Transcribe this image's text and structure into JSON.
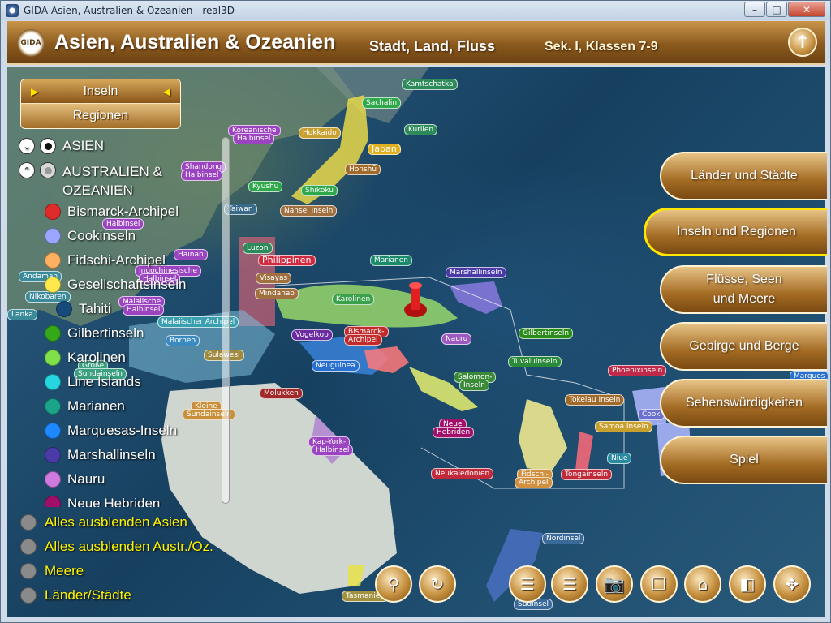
{
  "window": {
    "title": "GIDA Asien, Australien & Ozeanien - real3D",
    "min": "–",
    "max": "□",
    "close": "✕"
  },
  "header": {
    "logo": "GIDA",
    "title": "Asien, Australien & Ozeanien",
    "subtitle": "Stadt, Land, Fluss",
    "grade": "Sek. I, Klassen 7-9",
    "up_icon": "↑"
  },
  "tabs": {
    "active": "Inseln",
    "other": "Regionen",
    "arrow_left": "▶",
    "arrow_right": "◀"
  },
  "tree": {
    "asia": {
      "toggle": "⌄",
      "label": "ASIEN"
    },
    "oceania": {
      "toggle": "⌃",
      "label_1": "AUSTRALIEN &",
      "label_2": "OZEANIEN"
    },
    "items": [
      {
        "label": "Bismarck-Archipel",
        "color": "#e02b2b"
      },
      {
        "label": "Cookinseln",
        "color": "#9aa6ff"
      },
      {
        "label": "Fidschi-Archipel",
        "color": "#ffb060"
      },
      {
        "label": "Gesellschaftsinseln",
        "color": "#ffe94a"
      },
      {
        "label": "Tahiti",
        "color": "#174a7a",
        "sub": true
      },
      {
        "label": "Gilbertinseln",
        "color": "#35a81a"
      },
      {
        "label": "Karolinen",
        "color": "#7fe04a"
      },
      {
        "label": "Line Islands",
        "color": "#25d5e0"
      },
      {
        "label": "Marianen",
        "color": "#1aa58a"
      },
      {
        "label": "Marquesas-Inseln",
        "color": "#1e88ff"
      },
      {
        "label": "Marshallinseln",
        "color": "#4a3aa8"
      },
      {
        "label": "Nauru",
        "color": "#d07ae0"
      },
      {
        "label": "Neue Hebriden",
        "color": "#a0106a"
      }
    ]
  },
  "options": [
    {
      "label": "Alles ausblenden Asien"
    },
    {
      "label": "Alles ausblenden Austr./Oz."
    },
    {
      "label": "Meere"
    },
    {
      "label": "Länder/Städte"
    }
  ],
  "nav": [
    {
      "label": "Länder und Städte"
    },
    {
      "label": "Inseln und Regionen",
      "active": true
    },
    {
      "label_1": "Flüsse, Seen",
      "label_2": "und Meere"
    },
    {
      "label": "Gebirge und Berge"
    },
    {
      "label": "Sehenswürdigkeiten"
    },
    {
      "label": "Spiel"
    }
  ],
  "toolbar": {
    "pin": "⚲",
    "reset": "↻",
    "list1": "☰",
    "list2": "☰",
    "camera": "📷",
    "copy": "❐",
    "home": "⌂",
    "window": "◧",
    "move": "✥"
  },
  "map_labels": [
    {
      "text": "Kamtschatka",
      "bg": "#2e8a5a"
    },
    {
      "text": "Sachalin",
      "bg": "#2ea84a"
    },
    {
      "text": "Kurilen",
      "bg": "#2e8a5a"
    },
    {
      "text": "Koreanische",
      "bg": "#9a44c0"
    },
    {
      "text": "Halbinsel",
      "bg": "#9a44c0"
    },
    {
      "text": "Hokkaido",
      "bg": "#c8a030"
    },
    {
      "text": "Japan",
      "bg": "#e0b020"
    },
    {
      "text": "Honshū",
      "bg": "#a06a2a"
    },
    {
      "text": "Shandong",
      "bg": "#9a44c0"
    },
    {
      "text": "Halbinsel",
      "bg": "#9a44c0"
    },
    {
      "text": "Kyushu",
      "bg": "#2ea84a"
    },
    {
      "text": "Shikoku",
      "bg": "#2ea84a"
    },
    {
      "text": "Nansei Inseln",
      "bg": "#a07040"
    },
    {
      "text": "Taiwan",
      "bg": "#3a6a8a"
    },
    {
      "text": "Luzon",
      "bg": "#2e8a5a"
    },
    {
      "text": "Philippinen",
      "bg": "#d02a40"
    },
    {
      "text": "Visayas",
      "bg": "#a07040"
    },
    {
      "text": "Mindanao",
      "bg": "#a07040"
    },
    {
      "text": "Hainan",
      "bg": "#9a44c0"
    },
    {
      "text": "Indochinesische",
      "bg": "#9a44c0"
    },
    {
      "text": "Halbinsel",
      "bg": "#9a44c0"
    },
    {
      "text": "Malaiische",
      "bg": "#9a44c0"
    },
    {
      "text": "Halbinsel",
      "bg": "#9a44c0"
    },
    {
      "text": "Malaiischer Archipel",
      "bg": "#3aa0b0"
    },
    {
      "text": "Borneo",
      "bg": "#3a8ac0"
    },
    {
      "text": "Sulawesi",
      "bg": "#a08a40"
    },
    {
      "text": "Große",
      "bg": "#3aa080"
    },
    {
      "text": "Sundainseln",
      "bg": "#3aa080"
    },
    {
      "text": "Kleine",
      "bg": "#c8903a"
    },
    {
      "text": "Sundainseln",
      "bg": "#c8903a"
    },
    {
      "text": "Molukken",
      "bg": "#a02a2a"
    },
    {
      "text": "Vogelkop",
      "bg": "#6a2aa0"
    },
    {
      "text": "Bismarck-",
      "bg": "#c02a2a"
    },
    {
      "text": "Archipel",
      "bg": "#c02a2a"
    },
    {
      "text": "Neuguinea",
      "bg": "#2a70d0"
    },
    {
      "text": "Kap-York-",
      "bg": "#9a44c0"
    },
    {
      "text": "Halbinsel",
      "bg": "#9a44c0"
    },
    {
      "text": "Marianen",
      "bg": "#1a8a6a"
    },
    {
      "text": "Karolinen",
      "bg": "#3aa04a"
    },
    {
      "text": "Marshallinseln",
      "bg": "#4a3aa8"
    },
    {
      "text": "Nauru",
      "bg": "#9a5ac0"
    },
    {
      "text": "Gilbertinseln",
      "bg": "#2a8a1a"
    },
    {
      "text": "Tuvaluinseln",
      "bg": "#2a8a3a"
    },
    {
      "text": "Salomon-",
      "bg": "#3a8a3a"
    },
    {
      "text": "Inseln",
      "bg": "#3a8a3a"
    },
    {
      "text": "Phoenixinseln",
      "bg": "#c02a4a"
    },
    {
      "text": "Tokelau Inseln",
      "bg": "#a06a2a"
    },
    {
      "text": "Samoa Inseln",
      "bg": "#c8a030"
    },
    {
      "text": "Neue",
      "bg": "#a0106a"
    },
    {
      "text": "Hebriden",
      "bg": "#a0106a"
    },
    {
      "text": "Neukaledonien",
      "bg": "#c02a3a"
    },
    {
      "text": "Fidschi-",
      "bg": "#d09040"
    },
    {
      "text": "Archipel",
      "bg": "#d09040"
    },
    {
      "text": "Tongainseln",
      "bg": "#c02a3a"
    },
    {
      "text": "Niue",
      "bg": "#2a8aa0"
    },
    {
      "text": "Cook",
      "bg": "#6a70d0"
    },
    {
      "text": "Marques",
      "bg": "#2a70d0"
    },
    {
      "text": "Nordinsel",
      "bg": "#3a6a9a"
    },
    {
      "text": "Tasmanien",
      "bg": "#a09040"
    },
    {
      "text": "Südinsel",
      "bg": "#3a6a9a"
    },
    {
      "text": "Andaman",
      "bg": "#3a8a9a"
    },
    {
      "text": "Nikobaren",
      "bg": "#3a8a9a"
    },
    {
      "text": "Lanka",
      "bg": "#3a8a9a"
    },
    {
      "text": "Halbinsel",
      "bg": "#9a44c0"
    }
  ]
}
